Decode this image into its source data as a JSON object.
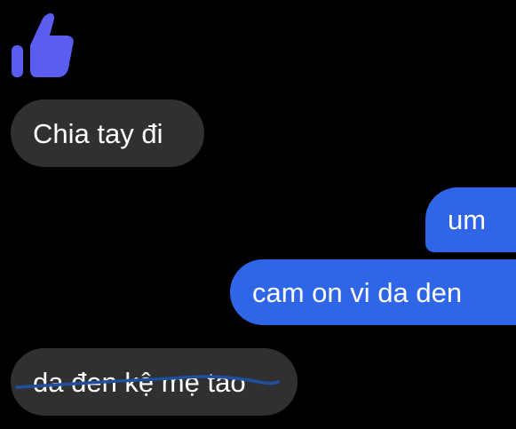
{
  "conversation": {
    "reaction": {
      "icon": "thumbs-up-icon",
      "color": "#5b5cf1"
    },
    "messages": [
      {
        "direction": "incoming",
        "text": "Chia tay đi"
      },
      {
        "direction": "outgoing",
        "text": "um"
      },
      {
        "direction": "outgoing",
        "text": "cam on vi da den"
      },
      {
        "direction": "incoming",
        "text": "da đen kệ mẹ tao"
      }
    ]
  },
  "colors": {
    "background": "#000000",
    "incoming_bubble": "#303030",
    "outgoing_bubble": "#2f66e8",
    "text": "#ffffff",
    "scribble": "#1f4f9e"
  }
}
